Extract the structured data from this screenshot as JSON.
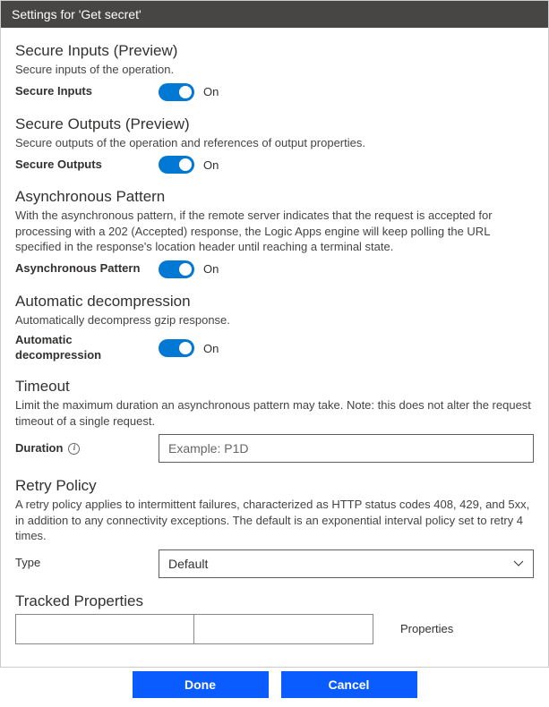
{
  "titlebar": "Settings for 'Get secret'",
  "sections": {
    "secureInputs": {
      "title": "Secure Inputs (Preview)",
      "desc": "Secure inputs of the operation.",
      "label": "Secure Inputs",
      "state": "On"
    },
    "secureOutputs": {
      "title": "Secure Outputs (Preview)",
      "desc": "Secure outputs of the operation and references of output properties.",
      "label": "Secure Outputs",
      "state": "On"
    },
    "asyncPattern": {
      "title": "Asynchronous Pattern",
      "desc": "With the asynchronous pattern, if the remote server indicates that the request is accepted for processing with a 202 (Accepted) response, the Logic Apps engine will keep polling the URL specified in the response's location header until reaching a terminal state.",
      "label": "Asynchronous Pattern",
      "state": "On"
    },
    "autoDecompress": {
      "title": "Automatic decompression",
      "desc": "Automatically decompress gzip response.",
      "label": "Automatic decompression",
      "state": "On"
    },
    "timeout": {
      "title": "Timeout",
      "desc": "Limit the maximum duration an asynchronous pattern may take. Note: this does not alter the request timeout of a single request.",
      "label": "Duration",
      "placeholder": "Example: P1D",
      "value": ""
    },
    "retry": {
      "title": "Retry Policy",
      "desc": "A retry policy applies to intermittent failures, characterized as HTTP status codes 408, 429, and 5xx, in addition to any connectivity exceptions. The default is an exponential interval policy set to retry 4 times.",
      "label": "Type",
      "selected": "Default"
    },
    "tracked": {
      "title": "Tracked Properties",
      "propLabel": "Properties"
    }
  },
  "buttons": {
    "done": "Done",
    "cancel": "Cancel"
  }
}
